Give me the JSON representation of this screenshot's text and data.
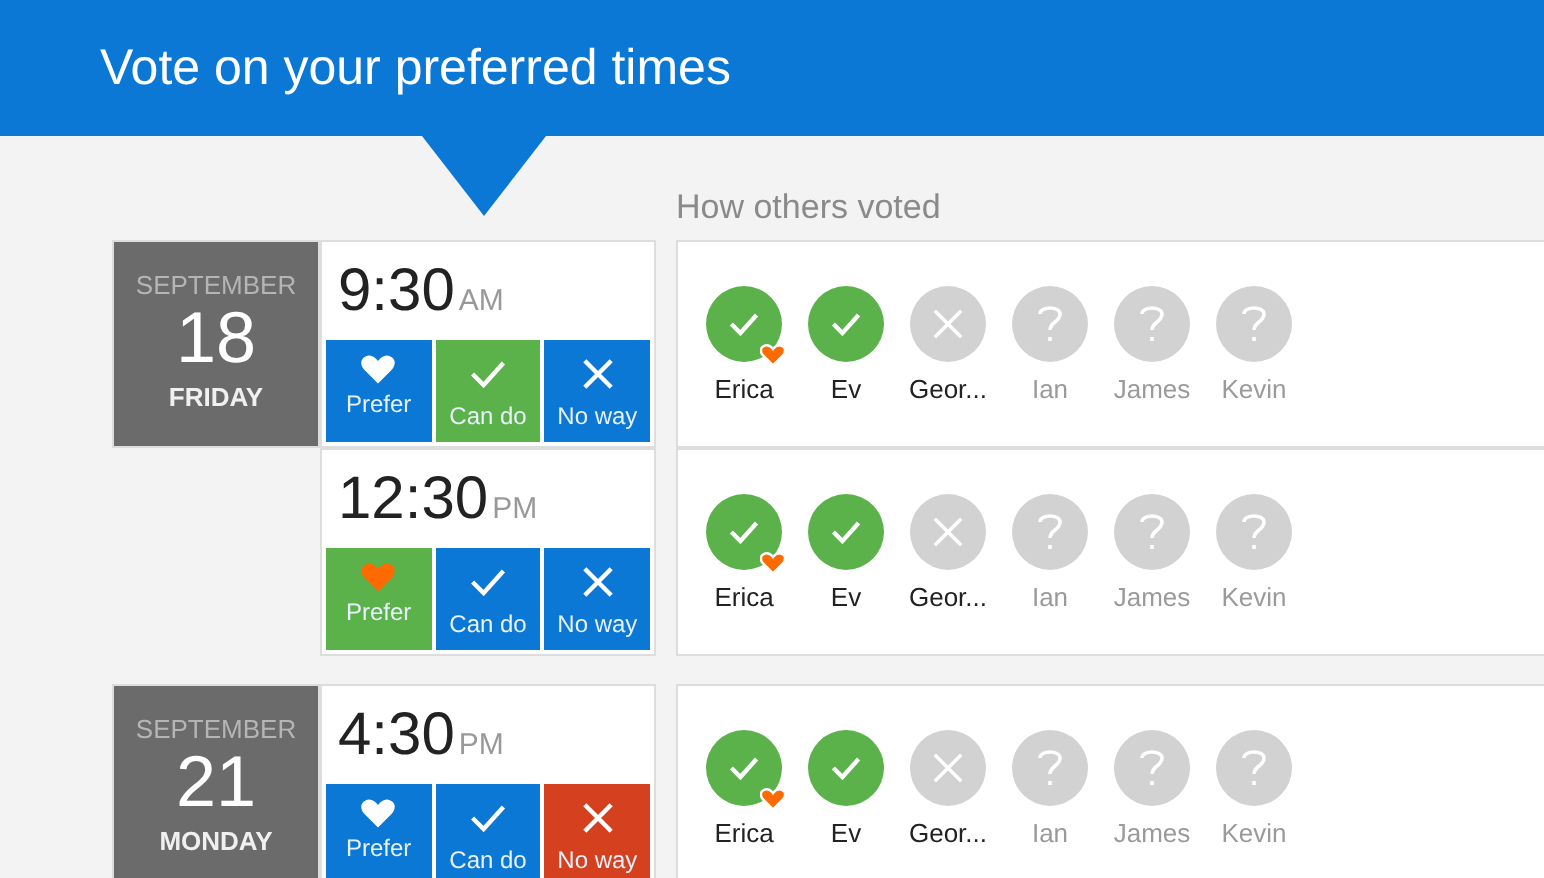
{
  "header": {
    "title": "Vote on your preferred times"
  },
  "others_label": "How others voted",
  "days": [
    {
      "month": "SEPTEMBER",
      "day": "18",
      "weekday": "FRIDAY",
      "slots": [
        {
          "time": "9:30",
          "ampm": "AM",
          "choices": [
            {
              "kind": "prefer",
              "label": "Prefer",
              "selected": false
            },
            {
              "kind": "cando",
              "label": "Can do",
              "selected": true
            },
            {
              "kind": "noway",
              "label": "No way",
              "selected": false
            }
          ],
          "voters": [
            {
              "name": "Erica",
              "kind": "yes",
              "prefer": true
            },
            {
              "name": "Ev",
              "kind": "yes",
              "prefer": false
            },
            {
              "name": "Geor...",
              "kind": "no",
              "prefer": false
            },
            {
              "name": "Ian",
              "kind": "unknown",
              "prefer": false
            },
            {
              "name": "James",
              "kind": "unknown",
              "prefer": false
            },
            {
              "name": "Kevin",
              "kind": "unknown",
              "prefer": false
            }
          ]
        },
        {
          "time": "12:30",
          "ampm": "PM",
          "choices": [
            {
              "kind": "prefer",
              "label": "Prefer",
              "selected": true
            },
            {
              "kind": "cando",
              "label": "Can do",
              "selected": false
            },
            {
              "kind": "noway",
              "label": "No way",
              "selected": false
            }
          ],
          "voters": [
            {
              "name": "Erica",
              "kind": "yes",
              "prefer": true
            },
            {
              "name": "Ev",
              "kind": "yes",
              "prefer": false
            },
            {
              "name": "Geor...",
              "kind": "no",
              "prefer": false
            },
            {
              "name": "Ian",
              "kind": "unknown",
              "prefer": false
            },
            {
              "name": "James",
              "kind": "unknown",
              "prefer": false
            },
            {
              "name": "Kevin",
              "kind": "unknown",
              "prefer": false
            }
          ]
        }
      ]
    },
    {
      "month": "SEPTEMBER",
      "day": "21",
      "weekday": "MONDAY",
      "slots": [
        {
          "time": "4:30",
          "ampm": "PM",
          "choices": [
            {
              "kind": "prefer",
              "label": "Prefer",
              "selected": false
            },
            {
              "kind": "cando",
              "label": "Can do",
              "selected": false
            },
            {
              "kind": "noway",
              "label": "No way",
              "selected": true
            }
          ],
          "voters": [
            {
              "name": "Erica",
              "kind": "yes",
              "prefer": true
            },
            {
              "name": "Ev",
              "kind": "yes",
              "prefer": false
            },
            {
              "name": "Geor...",
              "kind": "no",
              "prefer": false
            },
            {
              "name": "Ian",
              "kind": "unknown",
              "prefer": false
            },
            {
              "name": "James",
              "kind": "unknown",
              "prefer": false
            },
            {
              "name": "Kevin",
              "kind": "unknown",
              "prefer": false
            }
          ]
        }
      ]
    }
  ]
}
